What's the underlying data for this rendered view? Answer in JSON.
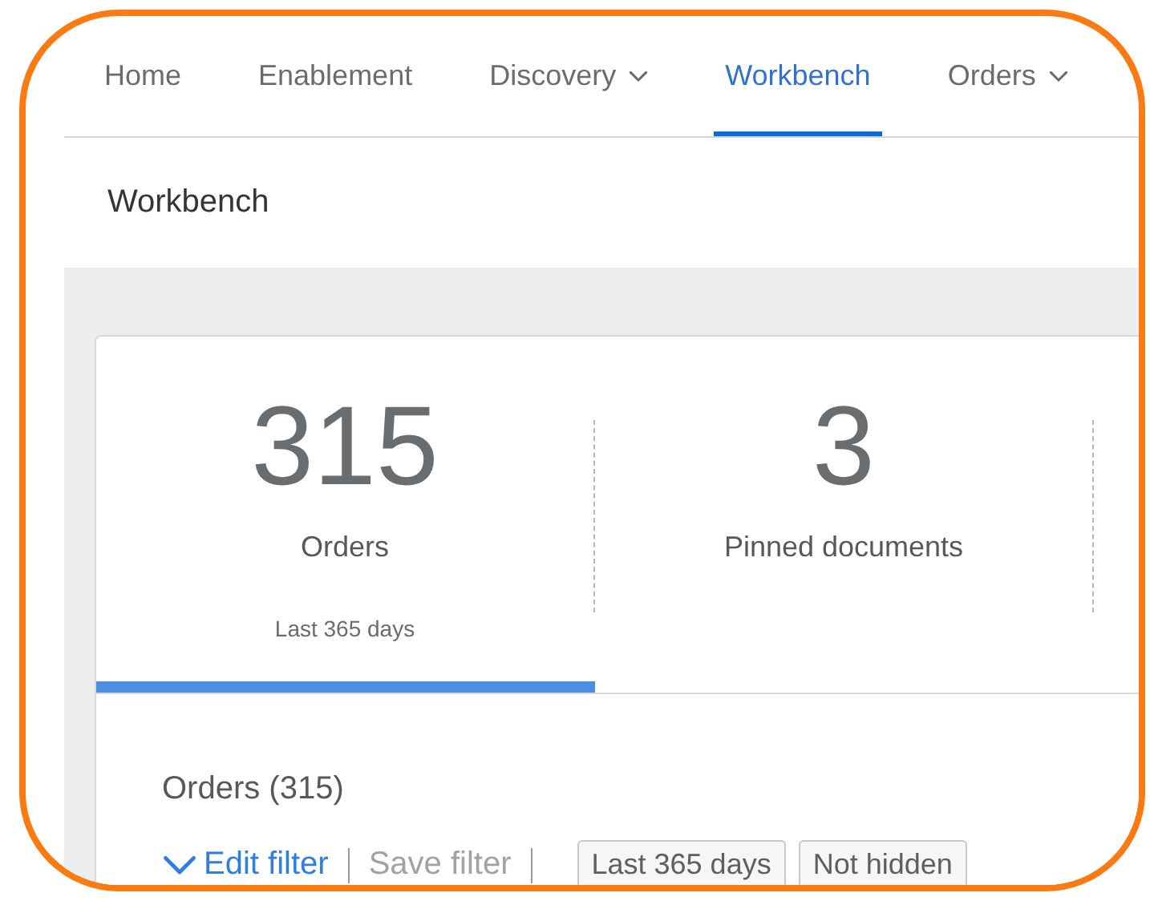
{
  "nav": {
    "tabs": [
      {
        "label": "Home",
        "selected": false,
        "dropdown": false
      },
      {
        "label": "Enablement",
        "selected": false,
        "dropdown": false
      },
      {
        "label": "Discovery",
        "selected": false,
        "dropdown": true
      },
      {
        "label": "Workbench",
        "selected": true,
        "dropdown": false
      },
      {
        "label": "Orders",
        "selected": false,
        "dropdown": true
      }
    ]
  },
  "page_title": "Workbench",
  "tiles": [
    {
      "value": "315",
      "label": "Orders",
      "period": "Last 365 days",
      "selected": true
    },
    {
      "value": "3",
      "label": "Pinned documents",
      "selected": false
    }
  ],
  "section": {
    "title": "Orders (315)",
    "edit_filter": "Edit filter",
    "save_filter": {
      "label": "Save filter",
      "disabled": true
    },
    "chips": [
      "Last 365 days",
      "Not hidden"
    ]
  }
}
